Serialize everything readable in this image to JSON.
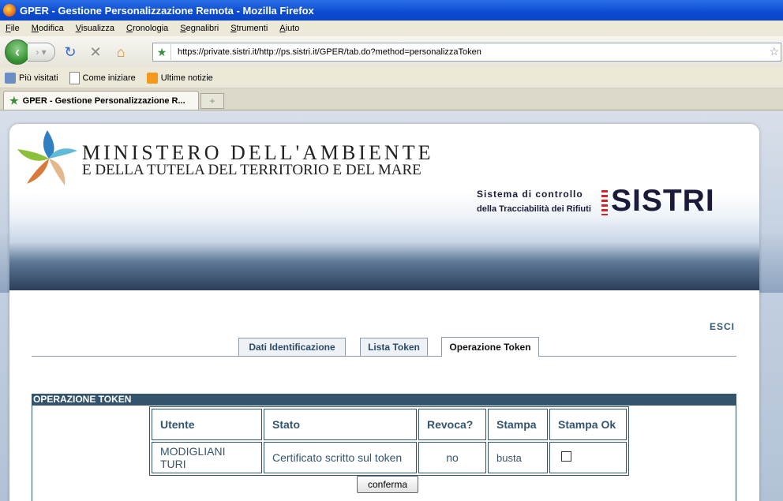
{
  "window": {
    "title": "GPER - Gestione Personalizzazione Remota - Mozilla Firefox"
  },
  "menu": [
    "File",
    "Modifica",
    "Visualizza",
    "Cronologia",
    "Segnalibri",
    "Strumenti",
    "Aiuto"
  ],
  "nav": {
    "url": "https://private.sistri.it/http://ps.sistri.it/GPER/tab.do?method=personalizzaToken",
    "icons": [
      "back-icon",
      "forward-icon",
      "dropdown-icon",
      "reload-icon",
      "stop-icon",
      "home-icon",
      "site-icon",
      "bookmark-star-icon"
    ]
  },
  "bookmarks": [
    "Più visitati",
    "Come iniziare",
    "Ultime notizie"
  ],
  "browser_tab": {
    "label": "GPER - Gestione Personalizzazione R...",
    "new_tab": "+"
  },
  "site": {
    "ministry_line1": "MINISTERO DELL'AMBIENTE",
    "ministry_line2": "E DELLA TUTELA DEL TERRITORIO E DEL MARE",
    "sistri_line1": "Sistema di controllo",
    "sistri_line2": "della Tracciabilità dei Rifiuti",
    "sistri_logo": "SISTRI"
  },
  "esci": "ESCI",
  "tabs": [
    "Dati Identificazione",
    "Lista Token",
    "Operazione Token"
  ],
  "active_tab": "Operazione Token",
  "section_title": "OPERAZIONE TOKEN",
  "table": {
    "headers": [
      "Utente",
      "Stato",
      "Revoca?",
      "Stampa",
      "Stampa Ok"
    ],
    "row": [
      "MODIGLIANI TURI",
      "Certificato scritto sul token",
      "no",
      "busta",
      ""
    ]
  },
  "confirm_label": "conferma",
  "colors": {
    "header_blue": "#34546e",
    "titlebar": "#0b4bd0"
  }
}
